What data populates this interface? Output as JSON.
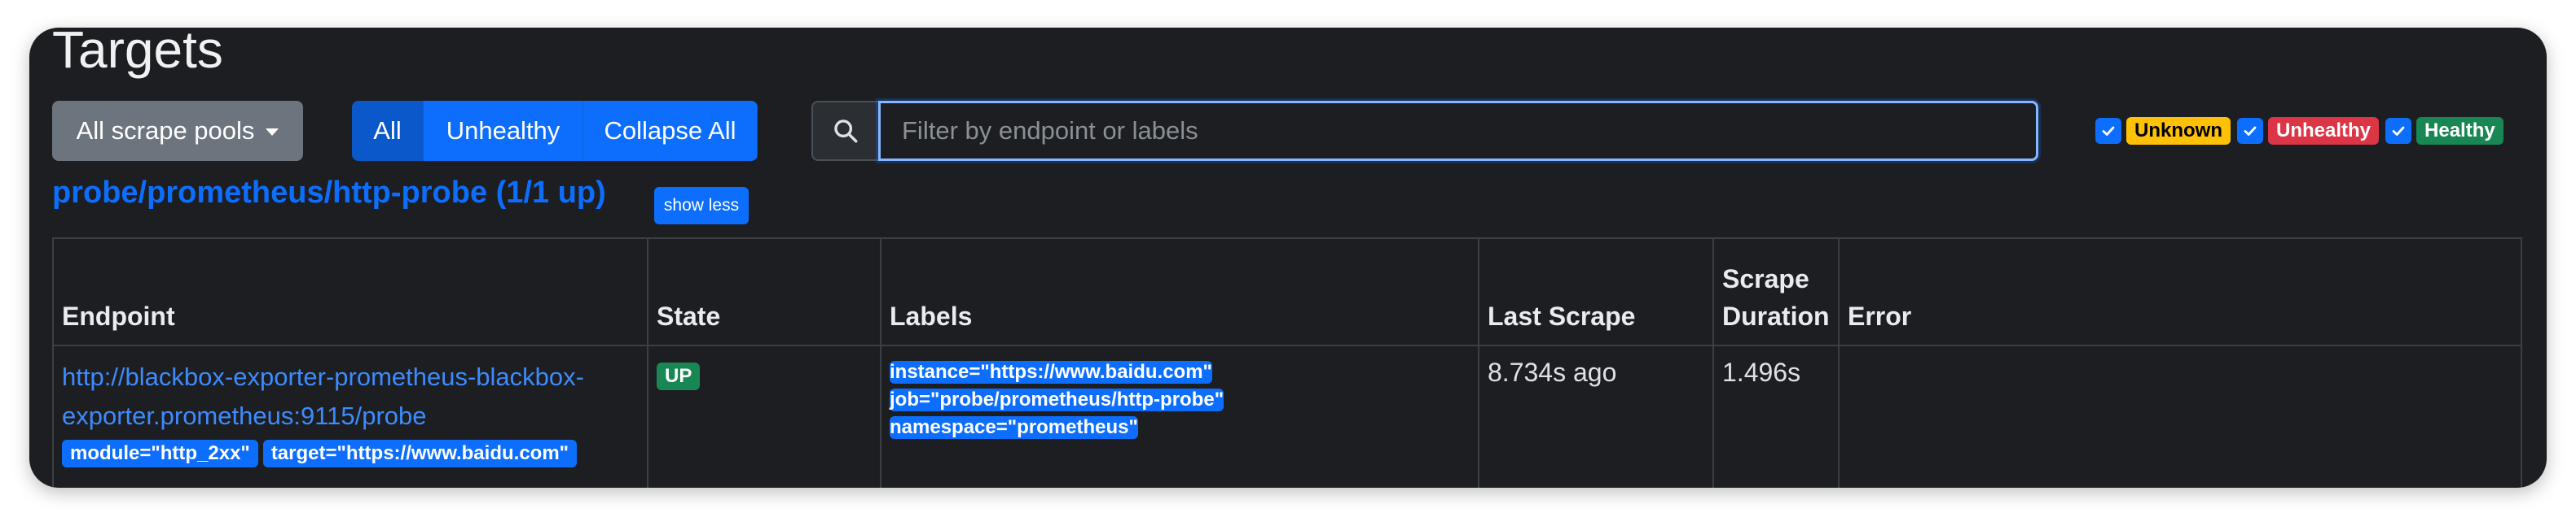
{
  "page": {
    "title": "Targets"
  },
  "toolbar": {
    "pools_label": "All scrape pools",
    "filter_buttons": [
      "All",
      "Unhealthy",
      "Collapse All"
    ],
    "search": {
      "placeholder": "Filter by endpoint or labels",
      "value": ""
    }
  },
  "health_filters": [
    {
      "label": "Unknown",
      "checked": true,
      "color": "#ffc107",
      "text_color": "#000000"
    },
    {
      "label": "Unhealthy",
      "checked": true,
      "color": "#dc3545",
      "text_color": "#ffffff"
    },
    {
      "label": "Healthy",
      "checked": true,
      "color": "#198754",
      "text_color": "#ffffff"
    }
  ],
  "pool": {
    "title": "probe/prometheus/http-probe (1/1 up)",
    "toggle_label": "show less"
  },
  "table": {
    "headers": {
      "endpoint": "Endpoint",
      "state": "State",
      "labels": "Labels",
      "last_scrape": "Last Scrape",
      "scrape_duration": "Scrape Duration",
      "error": "Error"
    },
    "rows": [
      {
        "endpoint_line1": "http://blackbox-exporter-prometheus-blackbox-",
        "endpoint_line2": "exporter.prometheus:9115/probe",
        "params": [
          "module=\"http_2xx\"",
          "target=\"https://www.baidu.com\""
        ],
        "state": "UP",
        "labels": [
          "instance=\"https://www.baidu.com\"",
          "job=\"probe/prometheus/http-probe\"",
          "namespace=\"prometheus\""
        ],
        "last_scrape": "8.734s ago",
        "scrape_duration": "1.496s",
        "error": ""
      }
    ]
  },
  "colors": {
    "accent": "#0d6efd",
    "background": "#1c1e21",
    "up": "#198754"
  }
}
